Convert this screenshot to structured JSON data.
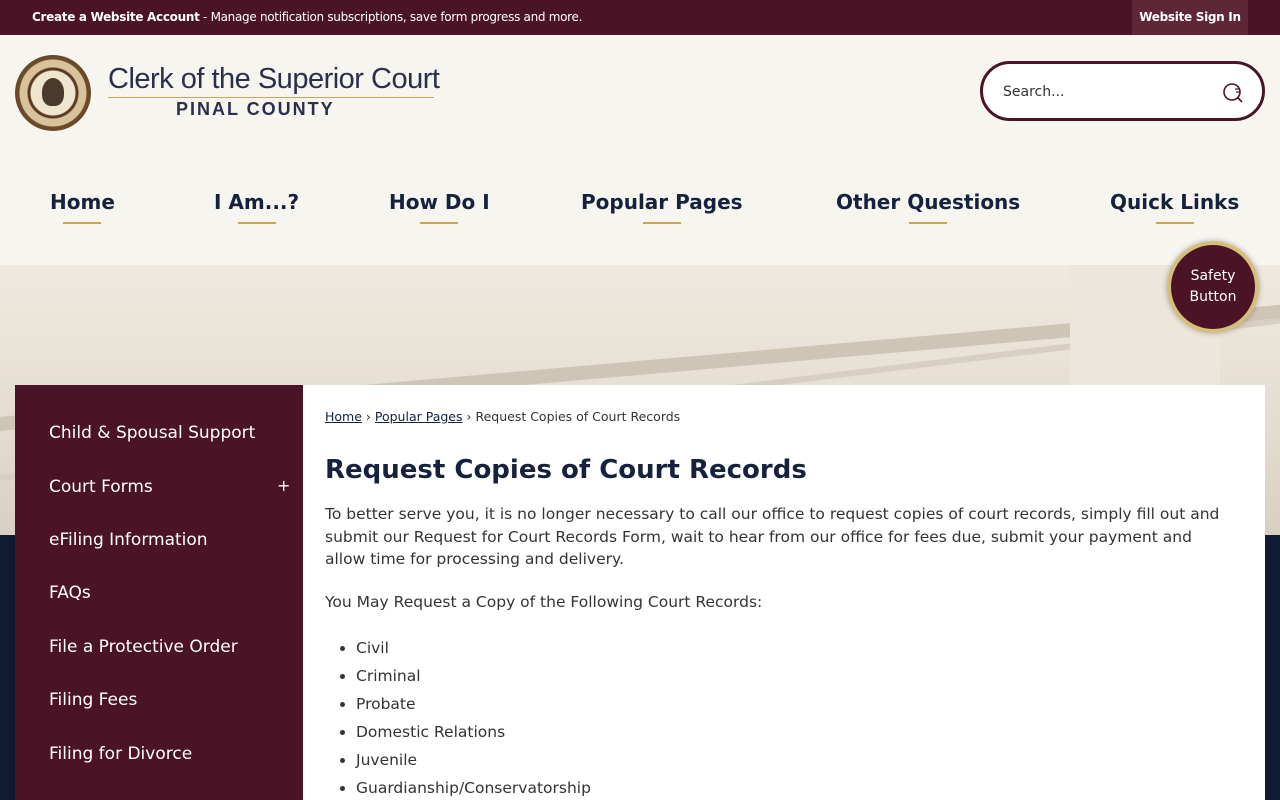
{
  "topbar": {
    "account_link": "Create a Website Account",
    "message": " - Manage notification subscriptions, save form progress and more.",
    "signin_label": "Website Sign In"
  },
  "logo": {
    "title": "Clerk of the Superior Court",
    "subtitle": "PINAL COUNTY"
  },
  "search": {
    "placeholder": "Search...",
    "icon": "search-icon"
  },
  "nav": {
    "items": [
      {
        "label": "Home"
      },
      {
        "label": "I Am...?"
      },
      {
        "label": "How Do I"
      },
      {
        "label": "Popular Pages"
      },
      {
        "label": "Other Questions"
      },
      {
        "label": "Quick Links"
      }
    ]
  },
  "safety_button": {
    "line1": "Safety",
    "line2": "Button"
  },
  "sidebar": {
    "items": [
      {
        "label": "Child & Spousal Support"
      },
      {
        "label": "Court Forms",
        "expand": "+"
      },
      {
        "label": "eFiling Information"
      },
      {
        "label": "FAQs"
      },
      {
        "label": "File a Protective Order"
      },
      {
        "label": "Filing Fees"
      },
      {
        "label": "Filing for Divorce"
      }
    ]
  },
  "breadcrumb": {
    "home": "Home",
    "sep": " › ",
    "popular": "Popular Pages",
    "current": "Request Copies of Court Records"
  },
  "main": {
    "title": "Request Copies of Court Records",
    "intro": "To better serve you, it is no longer necessary to call our office to request copies of court records, simply fill out and submit our Request for Court Records Form, wait to hear from our office for fees due, submit your payment and allow time for processing and delivery.",
    "lead": "You May Request a Copy of the Following Court Records:",
    "records": [
      "Civil",
      "Criminal",
      "Probate",
      "Domestic Relations",
      "Juvenile",
      "Guardianship/Conservatorship"
    ]
  },
  "colors": {
    "maroon": "#4a1426",
    "navy": "#15213d",
    "gold": "#c7a65a"
  }
}
